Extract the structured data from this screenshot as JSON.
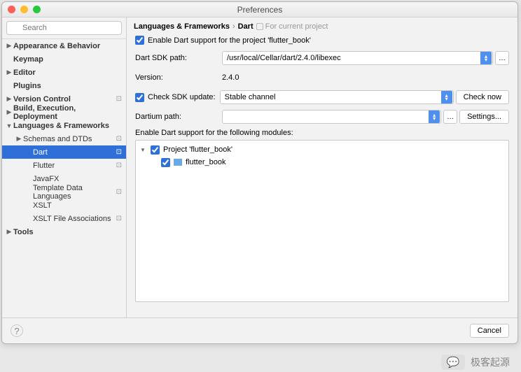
{
  "title": "Preferences",
  "search_placeholder": "Search",
  "sidebar": {
    "items": [
      {
        "label": "Appearance & Behavior",
        "bold": true,
        "arrow": "▶",
        "pad": 0,
        "gear": false
      },
      {
        "label": "Keymap",
        "bold": true,
        "arrow": "",
        "pad": 0,
        "gear": false
      },
      {
        "label": "Editor",
        "bold": true,
        "arrow": "▶",
        "pad": 0,
        "gear": false
      },
      {
        "label": "Plugins",
        "bold": true,
        "arrow": "",
        "pad": 0,
        "gear": false
      },
      {
        "label": "Version Control",
        "bold": true,
        "arrow": "▶",
        "pad": 0,
        "gear": true
      },
      {
        "label": "Build, Execution, Deployment",
        "bold": true,
        "arrow": "▶",
        "pad": 0,
        "gear": false
      },
      {
        "label": "Languages & Frameworks",
        "bold": true,
        "arrow": "▼",
        "pad": 0,
        "gear": false
      },
      {
        "label": "Schemas and DTDs",
        "bold": false,
        "arrow": "▶",
        "pad": 1,
        "gear": true
      },
      {
        "label": "Dart",
        "bold": false,
        "arrow": "",
        "pad": 2,
        "gear": true,
        "selected": true
      },
      {
        "label": "Flutter",
        "bold": false,
        "arrow": "",
        "pad": 2,
        "gear": true
      },
      {
        "label": "JavaFX",
        "bold": false,
        "arrow": "",
        "pad": 2,
        "gear": false
      },
      {
        "label": "Template Data Languages",
        "bold": false,
        "arrow": "",
        "pad": 2,
        "gear": true
      },
      {
        "label": "XSLT",
        "bold": false,
        "arrow": "",
        "pad": 2,
        "gear": false
      },
      {
        "label": "XSLT File Associations",
        "bold": false,
        "arrow": "",
        "pad": 2,
        "gear": true
      },
      {
        "label": "Tools",
        "bold": true,
        "arrow": "▶",
        "pad": 0,
        "gear": false
      }
    ]
  },
  "breadcrumb": {
    "root": "Languages & Frameworks",
    "leaf": "Dart",
    "scope": "For current project"
  },
  "form": {
    "enable_label": "Enable Dart support for the project 'flutter_book'",
    "enable_checked": true,
    "sdk_path_label": "Dart SDK path:",
    "sdk_path_value": "/usr/local/Cellar/dart/2.4.0/libexec",
    "version_label": "Version:",
    "version_value": "2.4.0",
    "check_sdk_label": "Check SDK update:",
    "check_sdk_checked": true,
    "channel_value": "Stable channel",
    "check_now": "Check now",
    "dartium_label": "Dartium path:",
    "dartium_value": "",
    "settings_btn": "Settings...",
    "modules_label": "Enable Dart support for the following modules:",
    "module_project": "Project 'flutter_book'",
    "module_child": "flutter_book"
  },
  "footer": {
    "cancel": "Cancel"
  },
  "watermark": "极客起源"
}
